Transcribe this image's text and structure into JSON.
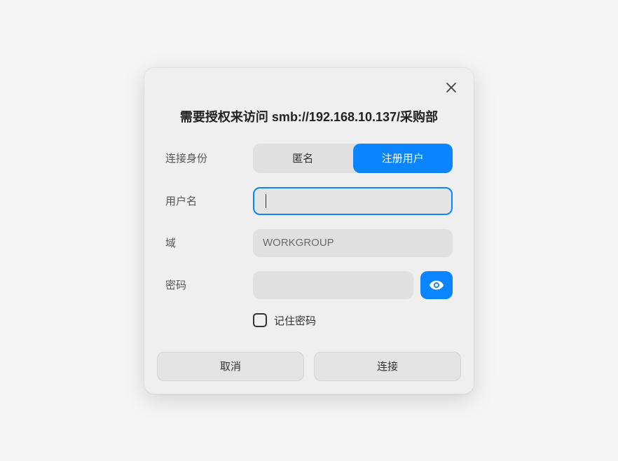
{
  "dialog": {
    "title": "需要授权来访问 smb://192.168.10.137/采购部",
    "identity": {
      "label": "连接身份",
      "anonymous": "匿名",
      "registered": "注册用户"
    },
    "username": {
      "label": "用户名",
      "value": ""
    },
    "domain": {
      "label": "域",
      "value": "WORKGROUP"
    },
    "password": {
      "label": "密码",
      "value": ""
    },
    "remember": {
      "label": "记住密码"
    },
    "buttons": {
      "cancel": "取消",
      "connect": "连接"
    }
  }
}
